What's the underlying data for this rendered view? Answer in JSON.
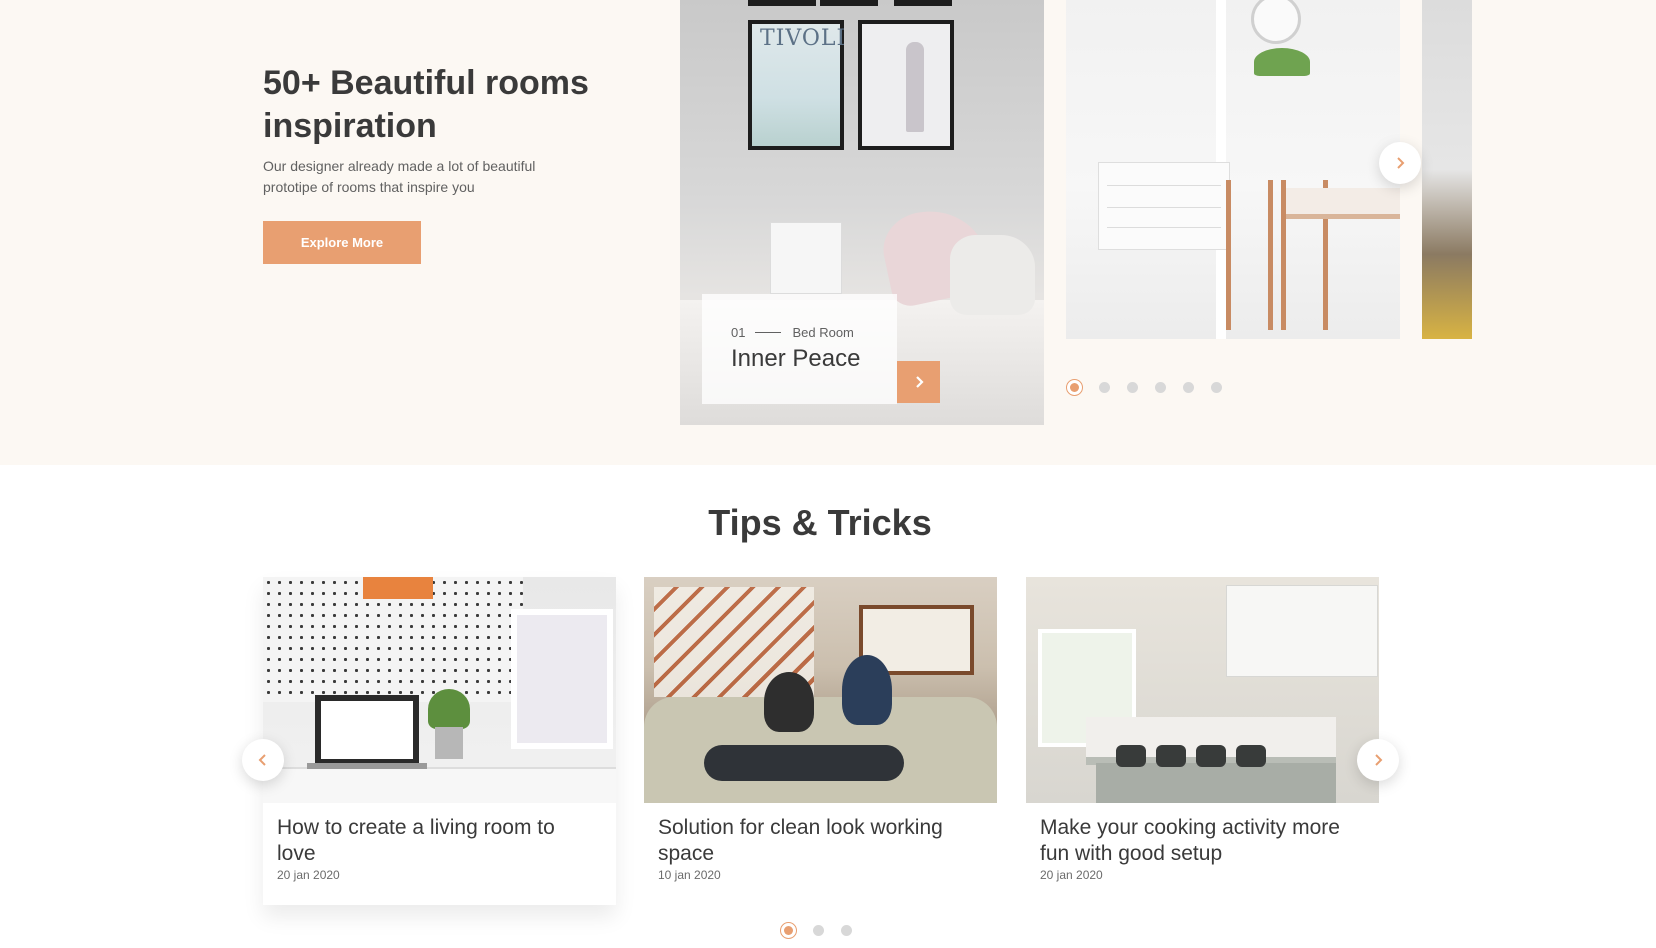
{
  "hero": {
    "title": "50+ Beautiful rooms inspiration",
    "subtitle": "Our designer already made a lot of beautiful prototipe of rooms that inspire you",
    "cta_label": "Explore More"
  },
  "room_slider": {
    "featured": {
      "number": "01",
      "category": "Bed Room",
      "name": "Inner Peace",
      "image_text": "TIVOLI"
    },
    "slide_count": 6,
    "active_index": 0
  },
  "tips": {
    "title": "Tips & Tricks",
    "posts": [
      {
        "title": "How to create a living room to love",
        "date": "20 jan 2020"
      },
      {
        "title": "Solution for clean look working space",
        "date": "10 jan 2020"
      },
      {
        "title": "Make your cooking activity more fun with good setup",
        "date": "20 jan 2020"
      }
    ],
    "slide_count": 3,
    "active_index": 0
  },
  "colors": {
    "accent": "#e89f71",
    "hero_background": "#fcf8f3",
    "heading_text": "#3a3a3a",
    "dot_inactive": "#d8d8d8"
  },
  "icons": {
    "slider_next": "chevron-right-icon",
    "slider_prev": "chevron-left-icon"
  }
}
